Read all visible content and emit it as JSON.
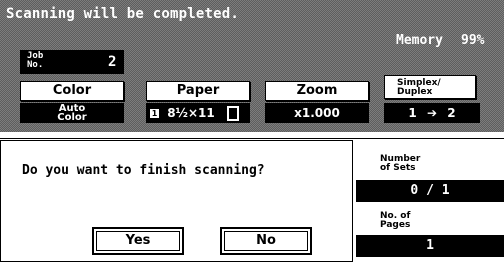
{
  "header": {
    "status_message": "Scanning will be completed.",
    "memory_label": "Memory",
    "memory_value": "99%"
  },
  "job": {
    "label_line1": "Job",
    "label_line2": "No.",
    "number": "2"
  },
  "settings": {
    "color": {
      "label": "Color",
      "value_line1": "Auto",
      "value_line2": "Color"
    },
    "paper": {
      "label": "Paper",
      "tray": "1",
      "size": "8½×11"
    },
    "zoom": {
      "label": "Zoom",
      "value": "x1.000"
    },
    "simplex": {
      "label_line1": "Simplex/",
      "label_line2": "Duplex",
      "from": "1",
      "to": "2"
    }
  },
  "dialog": {
    "question": "Do you want to finish scanning?",
    "yes_label": "Yes",
    "no_label": "No"
  },
  "counters": {
    "sets_label_line1": "Number",
    "sets_label_line2": "of Sets",
    "sets_value": "0 / 1",
    "pages_label_line1": "No. of",
    "pages_label_line2": "Pages",
    "pages_value": "1"
  }
}
